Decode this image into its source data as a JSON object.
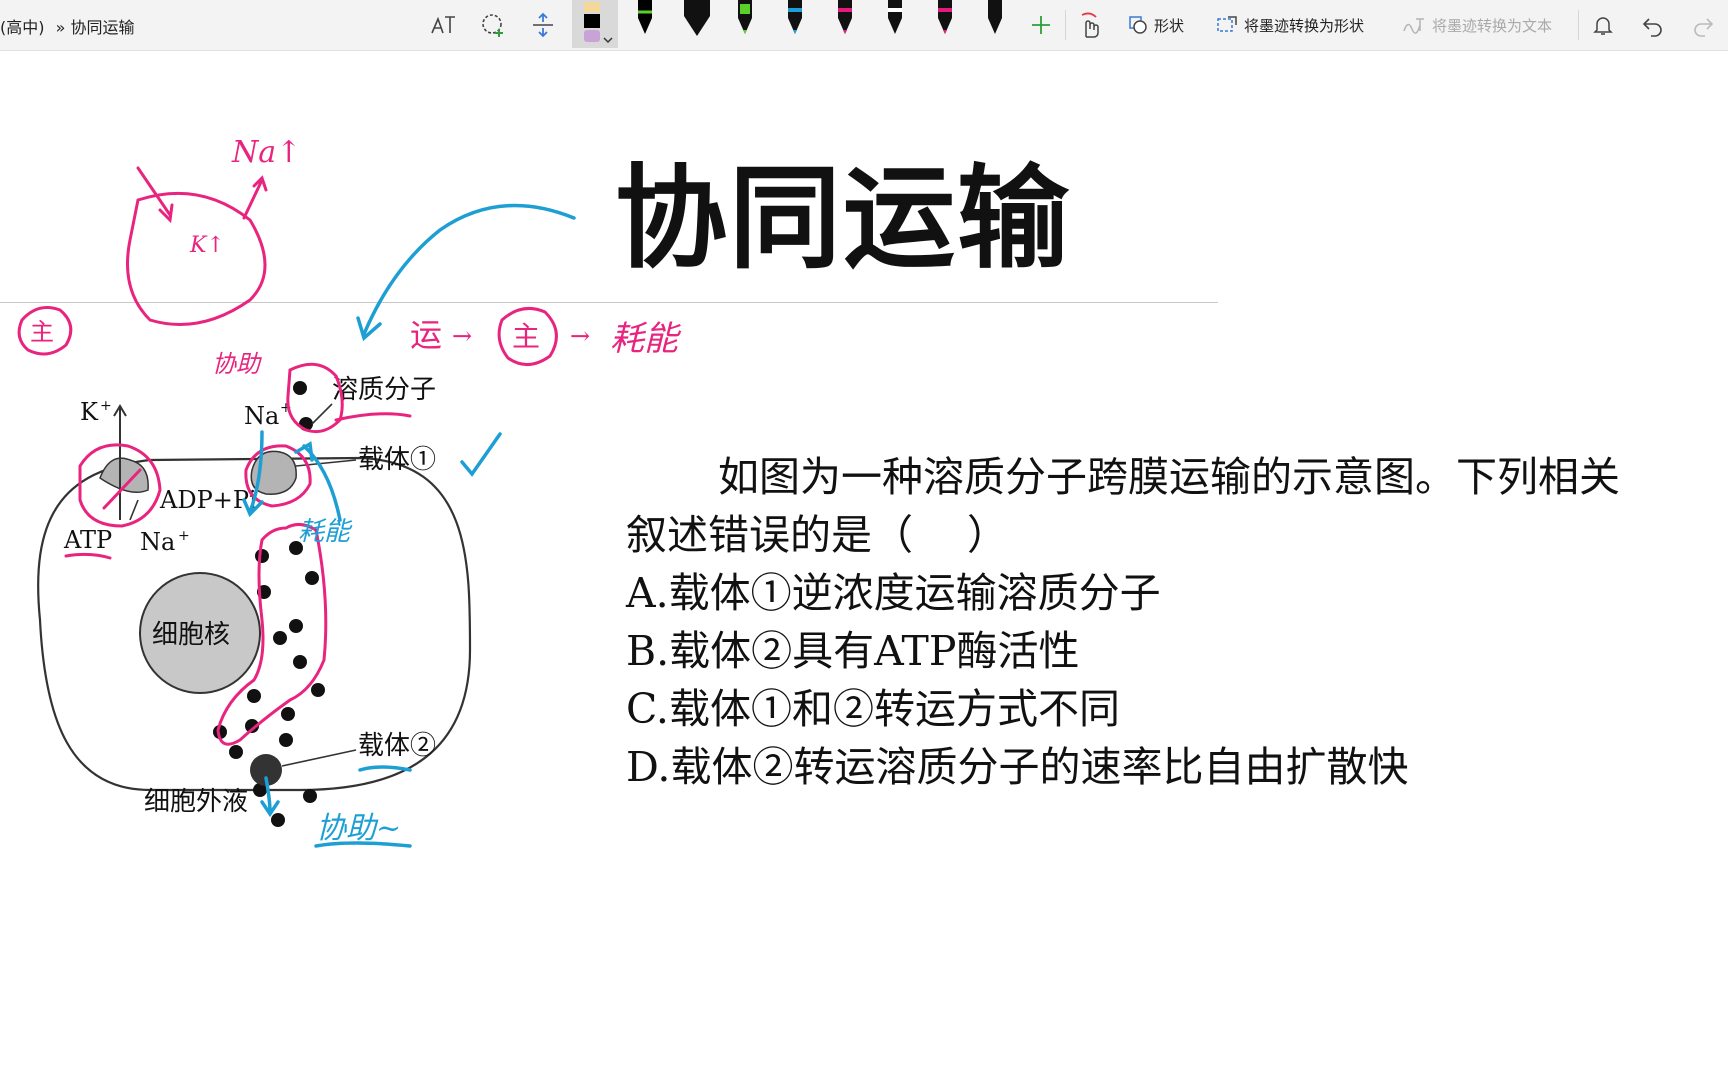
{
  "toolbar": {
    "breadcrumb": [
      "(高中)",
      "» 协同运输"
    ],
    "shapes_label": "形状",
    "ink_to_shape_label": "将墨迹转换为形状",
    "ink_to_text_label": "将墨迹转换为文本",
    "pens": [
      {
        "color": "#000000"
      },
      {
        "color": "#1a1a1a"
      },
      {
        "color": "#5ad12a"
      },
      {
        "color": "#1b9ed9"
      },
      {
        "color": "#e6197f"
      },
      {
        "color": "#ffffff"
      },
      {
        "color": "#e6197f"
      },
      {
        "color": "#111111"
      }
    ],
    "selected_swatch": {
      "top": "#f4d79a",
      "middle": "#000000",
      "bottom": "#c9a2d8"
    }
  },
  "slide": {
    "title": "协同运输",
    "question": {
      "stem": "如图为一种溶质分子跨膜运输的示意图。下列相关叙述错误的是（　 ）",
      "options": [
        "A.载体①逆浓度运输溶质分子",
        "B.载体②具有ATP酶活性",
        "C.载体①和②转运方式不同",
        "D.载体②转运溶质分子的速率比自由扩散快"
      ]
    },
    "diagram": {
      "k_label": "K",
      "na_top_label": "Na",
      "solute_label": "溶质分子",
      "carrier1_label": "载体①",
      "adp_label": "ADP+Pi",
      "atp_label": "ATP",
      "na_bottom_label": "Na",
      "nucleus_label": "细胞核",
      "carrier2_label": "载体②",
      "ecf_label": "细胞外液"
    },
    "annotations": {
      "na_k": "Na↑",
      "k_inner": "K↑",
      "circled_main": "主",
      "chain_prefix": "运",
      "chain_suffix": "耗能",
      "assist_top": "协助",
      "consume": "耗能",
      "assist_bottom": "协助~"
    },
    "colors": {
      "ink_pink": "#e8247f",
      "ink_blue": "#1e9fd4"
    }
  }
}
